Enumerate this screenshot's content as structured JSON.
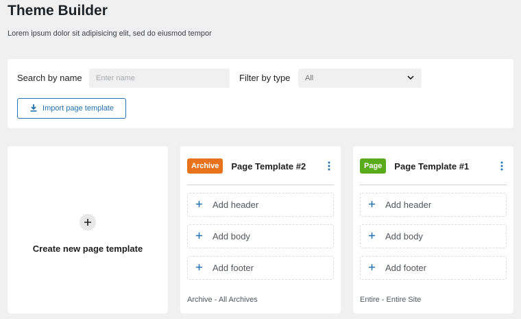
{
  "header": {
    "title": "Theme Builder",
    "subtitle": "Lorem ipsum dolor sit adipisicing elit, sed do eiusmod tempor"
  },
  "filters": {
    "search_label": "Search by name",
    "search_placeholder": "Enter name",
    "search_value": "",
    "type_label": "Filter by type",
    "type_value": "All",
    "import_label": "Import page template"
  },
  "create_card": {
    "label": "Create new page template"
  },
  "templates": [
    {
      "badge": "Archive",
      "badge_color": "#e8731c",
      "title": "Page Template #2",
      "slots": [
        "Add header",
        "Add body",
        "Add footer"
      ],
      "footer": "Archive - All Archives"
    },
    {
      "badge": "Page",
      "badge_color": "#5aab1c",
      "title": "Page Template #1",
      "slots": [
        "Add header",
        "Add body",
        "Add footer"
      ],
      "footer": "Entire - Entire Site"
    }
  ],
  "colors": {
    "accent": "#2271b1",
    "background": "#f0f0f1"
  },
  "icons": {
    "import": "download-icon",
    "select": "chevron-down-icon",
    "create": "plus-icon",
    "menu": "more-vertical-icon",
    "slot": "plus-icon"
  }
}
